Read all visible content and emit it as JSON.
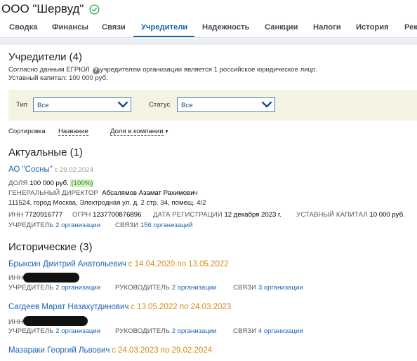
{
  "company": {
    "name": "ООО \"Шервуд\"",
    "verified_icon": "check-circle-icon",
    "verified_color": "#3aa757"
  },
  "tabs": [
    {
      "label": "Сводка"
    },
    {
      "label": "Финансы"
    },
    {
      "label": "Связи"
    },
    {
      "label": "Учредители",
      "active": true
    },
    {
      "label": "Надежность"
    },
    {
      "label": "Санкции"
    },
    {
      "label": "Налоги"
    },
    {
      "label": "История"
    },
    {
      "label": "Рек"
    }
  ],
  "founders": {
    "title": "Учредители (4)",
    "desc_prefix": "Согласно данным ЕГРЮЛ",
    "desc_suffix": "учредителем организации является 1 российское юридическое лицо.",
    "capital": "Уставный капитал: 100 000 руб."
  },
  "filters": {
    "type_label": "Тип",
    "type_value": "Все",
    "status_label": "Статус",
    "status_value": "Все"
  },
  "sort": {
    "label": "Сортировка",
    "option1": "Название",
    "option2": "Доля в компании",
    "option2_arrow": "▾"
  },
  "current": {
    "title": "Актуальные (1)",
    "org": {
      "name": "АО \"Сосны\"",
      "since": "с 29.02.2024",
      "share_label": "ДОЛЯ",
      "share_value": "100 000 руб.",
      "share_pct": "(100%)",
      "director_label": "ГЕНЕРАЛЬНЫЙ ДИРЕКТОР",
      "director_name": "Абсалямов Азамат Рахимович",
      "address": "111524, город Москва, Электродная ул. д. 2 стр. 34, помещ. 4/2",
      "inn_label": "ИНН",
      "inn": "7720916777",
      "ogrn_label": "ОГРН",
      "ogrn": "1237700876896",
      "reg_label": "ДАТА РЕГИСТРАЦИИ",
      "reg_date": "12 декабря 2023 г.",
      "capital_label": "УСТАВНЫЙ КАПИТАЛ",
      "capital_value": "10 000 руб.",
      "founder_label": "УЧРЕДИТЕЛЬ",
      "founder_link": "2 организации",
      "links_label": "СВЯЗИ",
      "links_link": "156 организаций"
    }
  },
  "historical": {
    "title": "Исторические (3)",
    "people": [
      {
        "name": "Брыксин Дмитрий Анатольевич",
        "period": "с 14.04.2020 по 13.05.2022",
        "inn_label": "ИНН",
        "founder_label": "УЧРЕДИТЕЛЬ",
        "founder_link": "2 организации",
        "head_label": "РУКОВОДИТЕЛЬ",
        "head_link": "2 организации",
        "links_label": "СВЯЗИ",
        "links_link": "3 организации"
      },
      {
        "name": "Сагдеев Марат Назахутдинович",
        "period": "с 13.05.2022 по 24.03.2023",
        "inn_label": "ИНН",
        "founder_label": "УЧРЕДИТЕЛЬ",
        "founder_link": "2 организации",
        "head_label": "РУКОВОДИТЕЛЬ",
        "head_link": "2 организации",
        "links_label": "СВЯЗИ",
        "links_link": "4 организации"
      },
      {
        "name": "Мазараки Георгий Львович",
        "period": "с 24.03.2023 по 29.02.2024"
      }
    ]
  },
  "colors": {
    "accent": "#1e64b4",
    "orange": "#d68a14",
    "filter_bg": "#f4f3e4"
  }
}
